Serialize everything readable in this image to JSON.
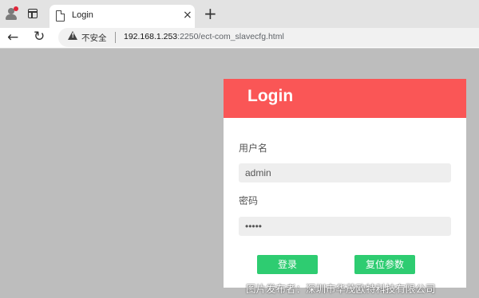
{
  "browser": {
    "tab_title": "Login",
    "tab_close": "×",
    "new_tab": "+",
    "security_label": "不安全",
    "url_host": "192.168.1.253",
    "url_rest": ":2250/ect-com_slavecfg.html"
  },
  "login": {
    "title": "Login",
    "username_label": "用户名",
    "username_value": "admin",
    "password_label": "密码",
    "password_value": "•••••",
    "login_button": "登录",
    "reset_button": "复位参数"
  },
  "watermark": "图片发布者：深圳市华茂欧特科技有限公司",
  "colors": {
    "header": "#fa5656",
    "button": "#2ecc71",
    "page_background": "#bdbdbd"
  }
}
